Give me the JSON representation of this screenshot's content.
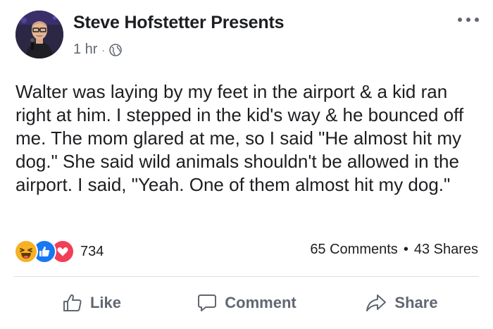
{
  "post": {
    "author": "Steve Hofstetter Presents",
    "time": "1 hr",
    "meta_separator": "·",
    "privacy_icon": "globe-icon",
    "text": "Walter was laying by my feet in the airport & a kid ran right at him. I stepped in the kid's way & he bounced off me. The mom glared at me, so I said \"He almost hit my dog.\" She said wild animals shouldn't be allowed in the airport. I said, \"Yeah. One of them almost hit my dog.\""
  },
  "reactions": {
    "icons": [
      "haha-reaction-icon",
      "like-reaction-icon",
      "love-reaction-icon"
    ],
    "count": "734"
  },
  "stats": {
    "comments": "65 Comments",
    "separator": "•",
    "shares": "43 Shares"
  },
  "actions": {
    "like": "Like",
    "comment": "Comment",
    "share": "Share"
  },
  "colors": {
    "text": "#1c1e21",
    "secondary": "#606770",
    "like_blue": "#1877f2",
    "love_red": "#f33e58",
    "haha_yellow": "#f7b125",
    "divider": "#dadde1"
  }
}
